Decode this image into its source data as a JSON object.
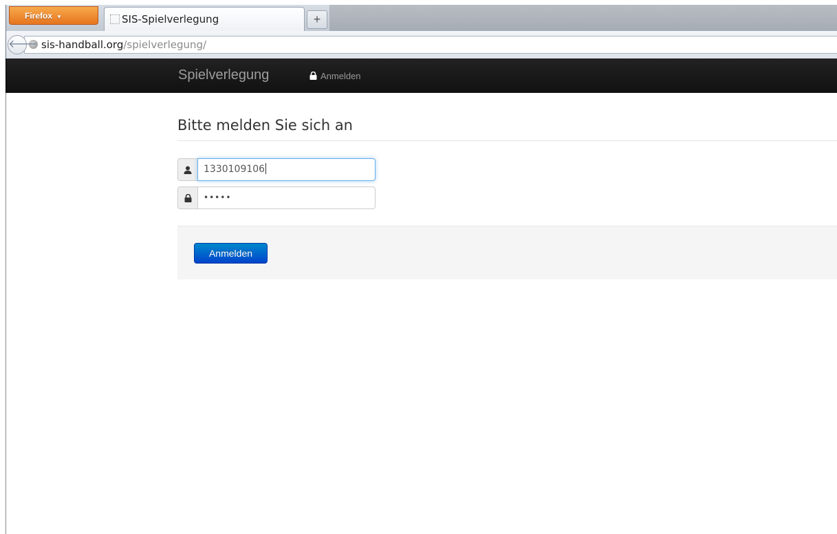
{
  "browser": {
    "menu_button": "Firefox",
    "tab_title": "SIS-Spielverlegung",
    "new_tab_symbol": "+",
    "url_host": "sis-handball.org",
    "url_path": "/spielverlegung/"
  },
  "navbar": {
    "brand": "Spielverlegung",
    "login_link": "Anmelden"
  },
  "login_form": {
    "heading": "Bitte melden Sie sich an",
    "username_value": "1330109106",
    "password_masked": "•••••",
    "submit_label": "Anmelden"
  },
  "colors": {
    "navbar_bg": "#111111",
    "primary_button": "#0044cc",
    "firefox_orange": "#e7751f"
  },
  "icons": {
    "user_addon": "user-icon",
    "password_addon": "lock-icon",
    "nav_login": "lock-icon"
  }
}
